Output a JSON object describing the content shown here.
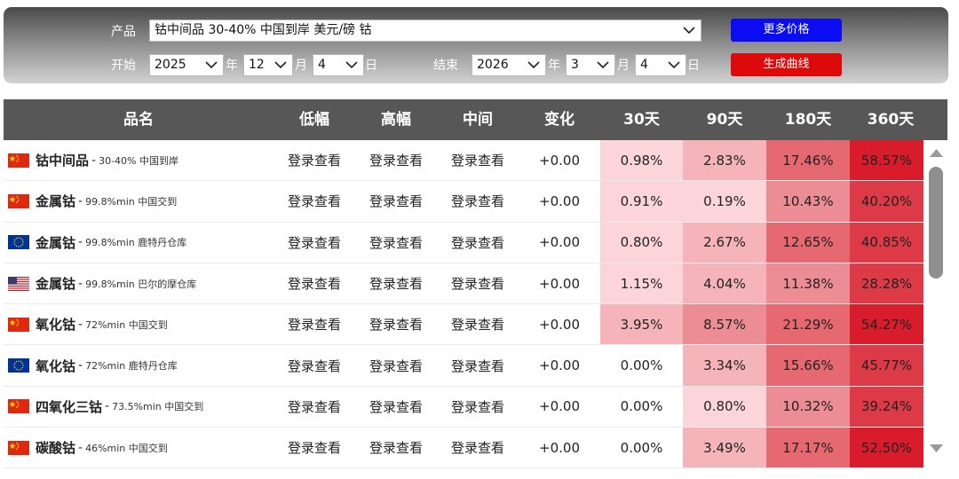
{
  "filters": {
    "product_label": "产品",
    "product_value": "钴中间品 30-40% 中国到岸 美元/磅 钴",
    "start_label": "开始",
    "end_label": "结束",
    "start": {
      "year": "2025",
      "month": "12",
      "day": "4"
    },
    "end": {
      "year": "2026",
      "month": "3",
      "day": "4"
    },
    "year_unit": "年",
    "month_unit": "月",
    "day_unit": "日",
    "more_prices_button": "更多价格",
    "generate_curve_button": "生成曲线"
  },
  "table": {
    "columns": [
      "品名",
      "低幅",
      "高幅",
      "中间",
      "变化",
      "30天",
      "90天",
      "180天",
      "360天"
    ],
    "rows": [
      {
        "flag": "china-flag-icon",
        "name": "钴中间品",
        "spec": "30-40% 中国到岸",
        "low": "登录查看",
        "high": "登录查看",
        "mid": "登录查看",
        "change": "+0.00",
        "d30": "0.98%",
        "d90": "2.83%",
        "d180": "17.46%",
        "d360": "58.57%"
      },
      {
        "flag": "china-flag-icon",
        "name": "金属钴",
        "spec": "99.8%min 中国交到",
        "low": "登录查看",
        "high": "登录查看",
        "mid": "登录查看",
        "change": "+0.00",
        "d30": "0.91%",
        "d90": "0.19%",
        "d180": "10.43%",
        "d360": "40.20%"
      },
      {
        "flag": "eu-flag-icon",
        "name": "金属钴",
        "spec": "99.8%min 鹿特丹仓库",
        "low": "登录查看",
        "high": "登录查看",
        "mid": "登录查看",
        "change": "+0.00",
        "d30": "0.80%",
        "d90": "2.67%",
        "d180": "12.65%",
        "d360": "40.85%"
      },
      {
        "flag": "us-flag-icon",
        "name": "金属钴",
        "spec": "99.8%min 巴尔的摩仓库",
        "low": "登录查看",
        "high": "登录查看",
        "mid": "登录查看",
        "change": "+0.00",
        "d30": "1.15%",
        "d90": "4.04%",
        "d180": "11.38%",
        "d360": "28.28%"
      },
      {
        "flag": "china-flag-icon",
        "name": "氧化钴",
        "spec": "72%min 中国交到",
        "low": "登录查看",
        "high": "登录查看",
        "mid": "登录查看",
        "change": "+0.00",
        "d30": "3.95%",
        "d90": "8.57%",
        "d180": "21.29%",
        "d360": "54.27%"
      },
      {
        "flag": "eu-flag-icon",
        "name": "氧化钴",
        "spec": "72%min 鹿特丹仓库",
        "low": "登录查看",
        "high": "登录查看",
        "mid": "登录查看",
        "change": "+0.00",
        "d30": "0.00%",
        "d90": "3.34%",
        "d180": "15.66%",
        "d360": "45.77%"
      },
      {
        "flag": "china-flag-icon",
        "name": "四氧化三钴",
        "spec": "73.5%min 中国交到",
        "low": "登录查看",
        "high": "登录查看",
        "mid": "登录查看",
        "change": "+0.00",
        "d30": "0.00%",
        "d90": "0.80%",
        "d180": "10.32%",
        "d360": "39.24%"
      },
      {
        "flag": "china-flag-icon",
        "name": "碳酸钴",
        "spec": "46%min 中国交到",
        "low": "登录查看",
        "high": "登录查看",
        "mid": "登录查看",
        "change": "+0.00",
        "d30": "0.00%",
        "d90": "3.49%",
        "d180": "17.17%",
        "d360": "52.50%"
      }
    ]
  },
  "heat_colors": {
    "none": "#ffffff",
    "level1": "#fbd5d9",
    "level2": "#f5b4ba",
    "level3": "#ec8d95",
    "level4": "#e66870",
    "level5": "#dc3a46",
    "level6": "#d81c2c"
  },
  "flag_colors": {
    "china_red": "#de2910",
    "china_star": "#ffde00",
    "eu_blue": "#003399",
    "eu_star": "#ffcc00",
    "us_red": "#b22234",
    "us_blue": "#3c3b6e"
  }
}
